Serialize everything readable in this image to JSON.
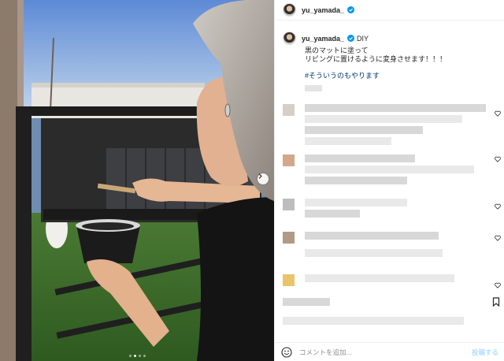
{
  "post": {
    "username": "yu_yamada_",
    "caption_tag": "DIY",
    "caption_lines": [
      "黒のマットに塗って",
      "リビングに置けるように変身させます！！！"
    ],
    "hashtag": "#そういうのもやります"
  },
  "carousel": {
    "slides": 4,
    "active": 1
  },
  "composer": {
    "placeholder": "コメントを追加...",
    "post_label": "投稿する"
  },
  "colors": {
    "link": "#00376b",
    "verified": "#0095f6",
    "post_button": "#b2dffc"
  },
  "icons": {
    "verified": "verified-badge-icon",
    "heart": "heart-icon",
    "emoji": "emoji-icon",
    "next": "chevron-right-icon",
    "save": "bookmark-icon"
  }
}
